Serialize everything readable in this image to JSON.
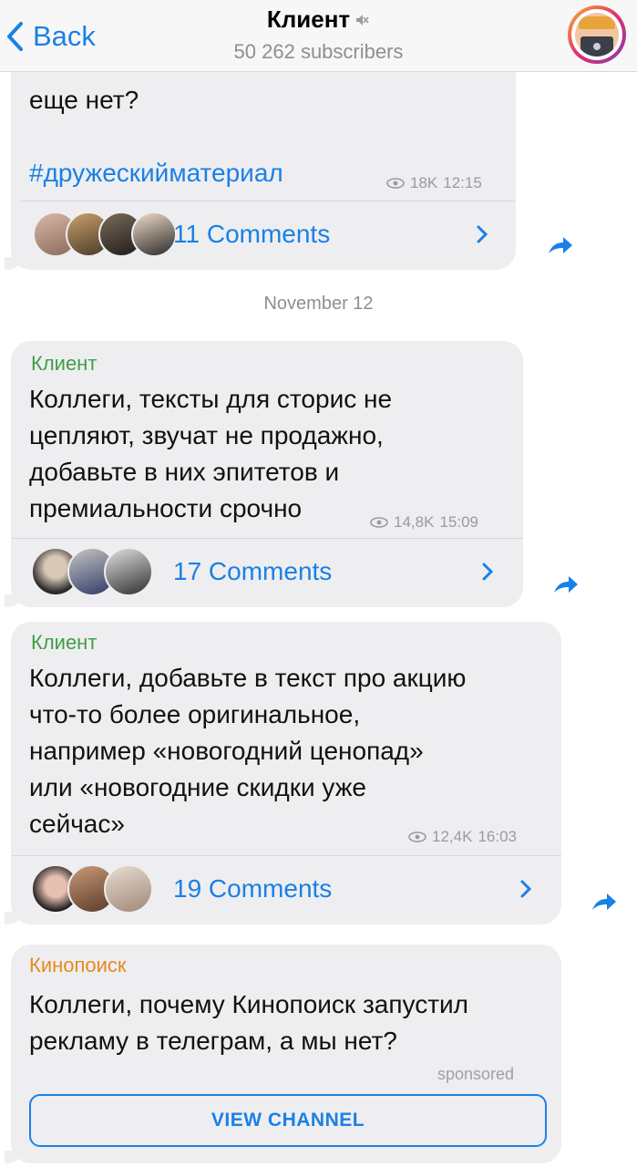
{
  "header": {
    "back_label": "Back",
    "title": "Клиент",
    "subtitle": "50 262 subscribers"
  },
  "feed": {
    "msg0": {
      "text_tail": "еще нет?",
      "hashtag": "#дружескийматериал",
      "views": "18K",
      "time": "12:15",
      "comments": "11 Comments"
    },
    "date_separator": "November 12",
    "msg1": {
      "sender": "Клиент",
      "text": "Коллеги, тексты для сторис не\nцепляют, звучат не продажно,\nдобавьте в них эпитетов и\nпремиальности срочно",
      "views": "14,8K",
      "time": "15:09",
      "comments": "17 Comments"
    },
    "msg2": {
      "sender": "Клиент",
      "text": "Коллеги, добавьте в текст про акцию\nчто-то более оригинальное,\nнапример «новогодний ценопад»\nили «новогодние скидки уже\nсейчас»",
      "views": "12,4K",
      "time": "16:03",
      "comments": "19 Comments"
    },
    "sponsored_msg": {
      "sender": "Кинопоиск",
      "text": "Коллеги, почему Кинопоиск запустил\nрекламу в телеграм, а мы нет?",
      "sponsored_label": "sponsored",
      "button_label": "VIEW CHANNEL"
    }
  },
  "colors": {
    "accent": "#1a80e6",
    "sender_green": "#3f9e48",
    "sponsor_orange": "#e58a1f",
    "bubble_bg": "#eeeef0"
  },
  "icons": [
    "chevron-left-icon",
    "mute-icon",
    "eye-icon",
    "chevron-right-icon",
    "share-icon"
  ]
}
